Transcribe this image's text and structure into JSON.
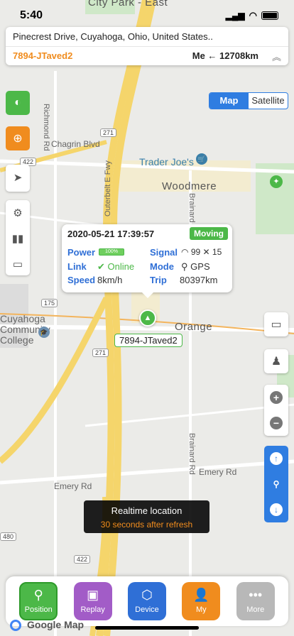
{
  "status_bar": {
    "time": "5:40"
  },
  "address_card": {
    "address": "Pinecrest Drive, Cuyahoga, Ohio, United States..",
    "device_name": "7894-JTaved2",
    "me_label": "Me",
    "distance": "12708km"
  },
  "map_type": {
    "options": [
      "Map",
      "Satellite"
    ],
    "selected": "Map"
  },
  "map_labels": {
    "city_park_east": "City Park\n- East",
    "richmond_rd": "Richmond Rd",
    "chagrin_blvd": "Chagrin Blvd",
    "outerbelt": "Outerbelt E Fwy",
    "trader_joes": "Trader Joe's",
    "woodmere": "Woodmere",
    "brainard_rd_top": "Brainard Rd",
    "brainard_rd_bottom": "Brainard Rd",
    "orange": "Orange",
    "cuyahoga_college": "Cuyahoga\nCommunity\nCollege",
    "emery_rd_left": "Emery Rd",
    "emery_rd_right": "Emery Rd",
    "shield_271_top": "271",
    "shield_271_mid": "271",
    "shield_422_top": "422",
    "shield_422_bottom": "422",
    "shield_175": "175",
    "shield_480": "480"
  },
  "popup": {
    "datetime": "2020-05-21 17:39:57",
    "state": "Moving",
    "power_label": "Power",
    "power_value": "100%",
    "signal_label": "Signal",
    "signal_wifi": "99",
    "signal_sat": "15",
    "link_label": "Link",
    "link_value": "Online",
    "mode_label": "Mode",
    "mode_value": "GPS",
    "speed_label": "Speed",
    "speed_value": "8km/h",
    "trip_label": "Trip",
    "trip_value": "80397km"
  },
  "marker_label": "7894-JTaved2",
  "toast": {
    "title": "Realtime location",
    "subtitle": "30 seconds after refresh"
  },
  "bottom_nav": [
    {
      "label": "Position",
      "color": "#4cb848"
    },
    {
      "label": "Replay",
      "color": "#a25cc7"
    },
    {
      "label": "Device",
      "color": "#2f6fd6"
    },
    {
      "label": "My",
      "color": "#f08c1e"
    },
    {
      "label": "More",
      "color": "#b8b8b8"
    }
  ],
  "google_label": "Google Map",
  "colors": {
    "accent_blue": "#2f7de1",
    "accent_orange": "#f08c1e",
    "accent_green": "#4cb848",
    "highway_yellow": "#f5d56b"
  }
}
